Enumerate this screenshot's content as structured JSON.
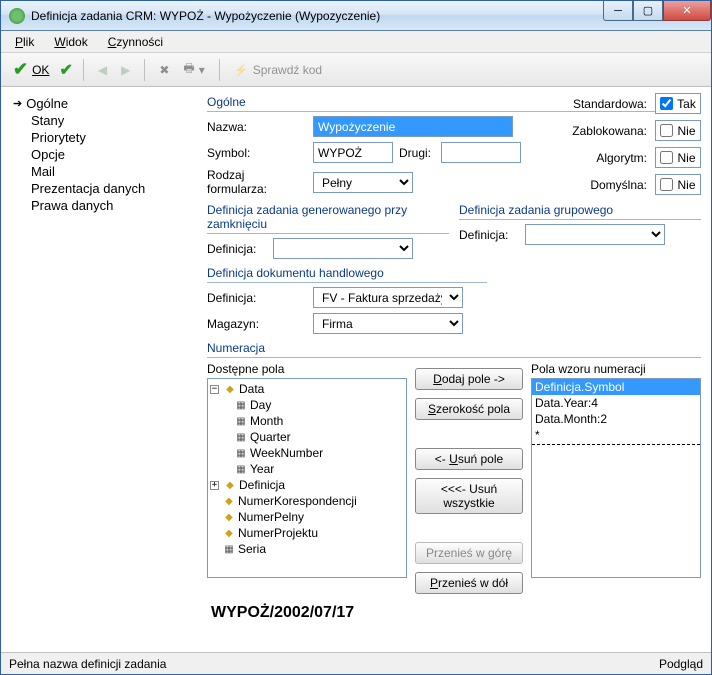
{
  "title": "Definicja zadania CRM: WYPOŻ - Wypożyczenie (Wypozyczenie)",
  "menu": {
    "plik": "Plik",
    "widok": "Widok",
    "czynnosci": "Czynności"
  },
  "toolbar": {
    "ok": "OK",
    "sprawdz": "Sprawdź kod"
  },
  "nav": {
    "ogolne": "Ogólne",
    "stany": "Stany",
    "priorytety": "Priorytety",
    "opcje": "Opcje",
    "mail": "Mail",
    "prezentacja": "Prezentacja danych",
    "prawa": "Prawa danych"
  },
  "groups": {
    "ogolne": "Ogólne",
    "defGenClose": "Definicja zadania generowanego przy zamknięciu",
    "defGroup": "Definicja zadania grupowego",
    "defDoc": "Definicja dokumentu handlowego",
    "numeracja": "Numeracja"
  },
  "labels": {
    "nazwa": "Nazwa:",
    "symbol": "Symbol:",
    "drugi": "Drugi:",
    "rodzaj": "Rodzaj formularza:",
    "definicja": "Definicja:",
    "magazyn": "Magazyn:",
    "dostepne": "Dostępne pola",
    "wzor": "Pola wzoru numeracji",
    "standardowa": "Standardowa:",
    "zablokowana": "Zablokowana:",
    "algorytm": "Algorytm:",
    "domyslna": "Domyślna:"
  },
  "values": {
    "nazwa": "Wypożyczenie",
    "symbol": "WYPOŻ",
    "drugi": "",
    "rodzaj": "Pełny",
    "defGenClose": "",
    "defGroup": "",
    "defDoc": "FV - Faktura sprzedaży",
    "magazyn": "Firma"
  },
  "checks": {
    "tak": "Tak",
    "nie": "Nie",
    "standardowa": true,
    "zablokowana": false,
    "algorytm": false,
    "domyslna": false
  },
  "buttons": {
    "dodaj": "Dodaj pole ->",
    "szer": "Szerokość pola",
    "usun": "<- Usuń pole",
    "usunW": "<<<- Usuń wszystkie",
    "gora": "Przenieś w górę",
    "dol": "Przenieś w dół"
  },
  "tree": {
    "data": "Data",
    "day": "Day",
    "month": "Month",
    "quarter": "Quarter",
    "week": "WeekNumber",
    "year": "Year",
    "definicja": "Definicja",
    "numerK": "NumerKorespondencji",
    "numerP": "NumerPelny",
    "numerProj": "NumerProjektu",
    "seria": "Seria"
  },
  "list": {
    "i0": "Definicja.Symbol",
    "i1": "Data.Year:4",
    "i2": "Data.Month:2"
  },
  "preview": "WYPOŻ/2002/07/17",
  "status": {
    "left": "Pełna nazwa definicji zadania",
    "right": "Podgląd"
  }
}
